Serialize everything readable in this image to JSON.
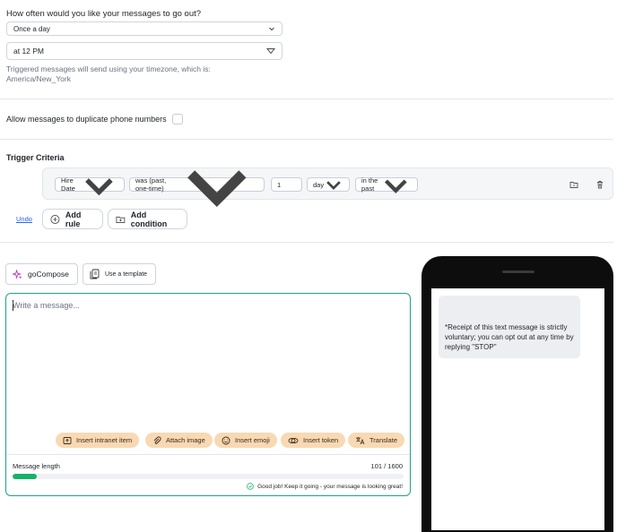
{
  "schedule": {
    "question": "How often would you like your messages to go out?",
    "frequency_value": "Once a day",
    "time_value": "at 12 PM",
    "timezone_hint_line1": "Triggered messages will send using your timezone, which is:",
    "timezone_hint_line2": "America/New_York"
  },
  "duplicates": {
    "label": "Allow messages to duplicate phone numbers",
    "checked": false
  },
  "trigger": {
    "title": "Trigger Criteria",
    "rule": {
      "field": "Hire Date",
      "operator": "was (past, one-time)",
      "amount": "1",
      "unit": "day",
      "direction": "in the past"
    },
    "undo_label": "Undo",
    "add_rule_label": "Add rule",
    "add_condition_label": "Add condition"
  },
  "composer": {
    "gocompose_label": "goCompose",
    "template_label": "Use a template",
    "placeholder": "Write a message...",
    "actions": [
      {
        "label": "Insert intranet item",
        "icon": "intranet-icon"
      },
      {
        "label": "Attach image",
        "icon": "paperclip-icon"
      },
      {
        "label": "Insert emoji",
        "icon": "emoji-icon"
      },
      {
        "label": "Insert token",
        "icon": "token-icon"
      },
      {
        "label": "Translate",
        "icon": "translate-icon"
      }
    ],
    "length_label": "Message length",
    "length_count": "101 / 1600",
    "length_fraction": 0.063,
    "feedback": "Good job! Keep it going - your message is looking great!"
  },
  "preview": {
    "bubble_text": "*Receipt of this text message is strictly voluntary; you can opt out at any time by replying \"STOP\""
  },
  "colors": {
    "accent_green": "#17b26a",
    "editor_border": "#23a28a",
    "chip_bg": "#f8d9b4",
    "link_blue": "#2563eb"
  }
}
